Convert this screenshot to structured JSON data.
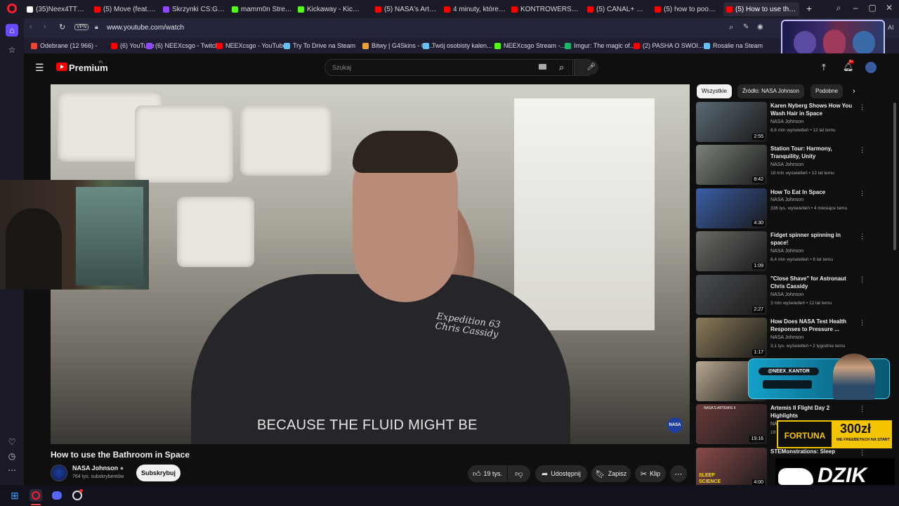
{
  "tabs": [
    {
      "label": "(35)Neex4TTV (@nee",
      "color": "#ffffff"
    },
    {
      "label": "(5) Move (feat. Ca",
      "color": "#ff0000"
    },
    {
      "label": "Skrzynki CS:GO/CS2 |",
      "color": "#9146ff"
    },
    {
      "label": "mamm0n Stream",
      "color": "#53fc18"
    },
    {
      "label": "Kickaway - Kick Givea",
      "color": "#53fc18"
    },
    {
      "label": "(5) NASA's Artemis II",
      "color": "#ff0000"
    },
    {
      "label": "4 minuty, które zdecy",
      "color": "#ff0000"
    },
    {
      "label": "KONTROWERSJE W K",
      "color": "#ff0000"
    },
    {
      "label": "(5) CANAL+ SPORT -",
      "color": "#ff0000"
    },
    {
      "label": "(5) how to poop in sp",
      "color": "#ff0000"
    },
    {
      "label": "(5) How to use the Ba",
      "color": "#ff0000"
    }
  ],
  "address": {
    "vpn": "VPN",
    "url": "www.youtube.com/watch"
  },
  "bookmarks": [
    {
      "label": "Odebrane (12 966) -",
      "color": "#ea4335"
    },
    {
      "label": "(6) YouTube",
      "color": "#ff0000"
    },
    {
      "label": "(6) NEEXcsgo - Twitch",
      "color": "#9146ff"
    },
    {
      "label": "NEEXcsgo - YouTube",
      "color": "#ff0000"
    },
    {
      "label": "Try To Drive na Steam",
      "color": "#66c0f4"
    },
    {
      "label": "Bitwy | G4Skins - Ot...",
      "color": "#e8a33d"
    },
    {
      "label": "Twój osobisty kalen...",
      "color": "#66c0f4"
    },
    {
      "label": "NEEXcsgo Stream -...",
      "color": "#53fc18"
    },
    {
      "label": "Imgur: The magic of...",
      "color": "#1bb76e"
    },
    {
      "label": "(2) PASHA O SWOI...",
      "color": "#ff0000"
    },
    {
      "label": "Rosalie na Steam",
      "color": "#66c0f4"
    }
  ],
  "browser_extra": {
    "ai_label": "AI"
  },
  "header": {
    "logo": "Premium",
    "region": "PL",
    "search_placeholder": "Szukaj",
    "notif_count": "9+"
  },
  "video": {
    "caption": "BECAUSE THE FLUID MIGHT BE",
    "shirt_line1": "Expedition 63",
    "shirt_line2": "Chris Cassidy",
    "nasa_badge": "NASA",
    "title": "How to use the Bathroom in Space"
  },
  "channel": {
    "name": "NASA Johnson",
    "subs": "764 tys. subskrybentów",
    "subscribe_label": "Subskrybuj"
  },
  "actions": {
    "likes": "19 tys.",
    "share": "Udostępnij",
    "save": "Zapisz",
    "clip": "Klip"
  },
  "chips": [
    "Wszystkie",
    "Źródło: NASA Johnson",
    "Podobne"
  ],
  "recommendations": [
    {
      "title": "Karen Nyberg Shows How You Wash Hair in Space",
      "channel": "NASA Johnson",
      "meta": "8,6 mln wyświetleń • 12 lat temu",
      "duration": "2:55",
      "thumb": "#5a6a74"
    },
    {
      "title": "Station Tour: Harmony, Tranquility, Unity",
      "channel": "NASA Johnson",
      "meta": "18 mln wyświetleń • 13 lat temu",
      "duration": "8:42",
      "thumb": "#7a8278"
    },
    {
      "title": "How To Eat In Space",
      "channel": "NASA Johnson",
      "meta": "336 tys. wyświetleń • 4 miesiące temu",
      "duration": "4:30",
      "thumb": "#3a5ea8"
    },
    {
      "title": "Fidget spinner spinning in space!",
      "channel": "NASA Johnson",
      "meta": "8,4 mln wyświetleń • 8 lat temu",
      "duration": "1:09",
      "thumb": "#6a6a66"
    },
    {
      "title": "\"Close Shave\" for Astronaut Chris Cassidy",
      "channel": "NASA Johnson",
      "meta": "3 mln wyświetleń • 12 lat temu",
      "duration": "2:27",
      "thumb": "#4a4e52"
    },
    {
      "title": "How Does NASA Test Health Responses to Pressure ...",
      "channel": "NASA Johnson",
      "meta": "3,1 tys. wyświetleń • 2 tygodnie temu",
      "duration": "1:17",
      "thumb": "#8a7a58"
    },
    {
      "title": "",
      "channel": "",
      "meta": "",
      "duration": "",
      "thumb": "#b8a890"
    },
    {
      "title": "Artemis II Flight Day 2 Highlights",
      "channel": "NA",
      "meta": "19",
      "duration": "19:16",
      "thumb": "#6a3a3a"
    },
    {
      "title": "STEMonstrations: Sleep",
      "channel": "",
      "meta": "",
      "duration": "4:00",
      "thumb": "#8a4a4a"
    }
  ],
  "overlays": {
    "kantor_handle": "@NEEX_KANTOR",
    "fortuna_brand": "FORTUNA",
    "fortuna_amount": "300zł",
    "fortuna_promo": "WE FREEBETACH NA START",
    "dzik": "DZIK",
    "thumb_badge1": "NASA'S ARTEMIS II",
    "thumb_badge2": "SLEEP SCIENCE"
  }
}
